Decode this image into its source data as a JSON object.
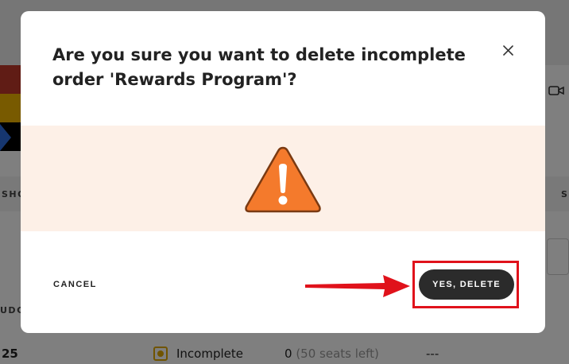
{
  "background": {
    "column_header_left": "SHO",
    "column_header_right": "S",
    "row_label": "UDG",
    "row": {
      "number": "25",
      "status": "Incomplete",
      "seats_count": "0",
      "seats_left": "(50 seats left)",
      "placeholder": "---"
    }
  },
  "modal": {
    "title": "Are you sure you want to delete incomplete order 'Rewards Program'?",
    "cancel_label": "CANCEL",
    "confirm_label": "YES, DELETE",
    "warning_color": "#f47a2c",
    "band_color": "#fdf0e7",
    "highlight_color": "#e0121b"
  }
}
